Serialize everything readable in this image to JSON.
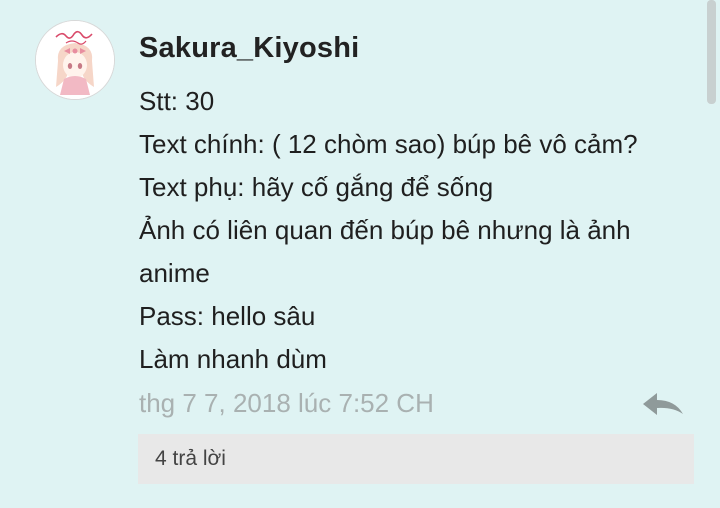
{
  "comment": {
    "avatar_icon": "user-avatar",
    "avatar_lettering": "Sakura Kiyoshi",
    "username": "Sakura_Kiyoshi",
    "lines": [
      "Stt: 30",
      "Text chính: ( 12 chòm sao) búp bê vô cảm?",
      "Text phụ: hãy cố gắng để sống",
      "Ảnh có liên quan đến búp bê nhưng là ảnh",
      "anime",
      "Pass: hello sâu",
      "Làm nhanh dùm"
    ],
    "timestamp": "thg 7 7, 2018 lúc 7:52 CH",
    "reply_icon": "reply-arrow-icon",
    "replies_label": "4 trả lời"
  },
  "colors": {
    "background": "#dff3f3",
    "text": "#1f1f1f",
    "timestamp": "#a9b1b1",
    "replies_bar": "#e8e8e8"
  }
}
